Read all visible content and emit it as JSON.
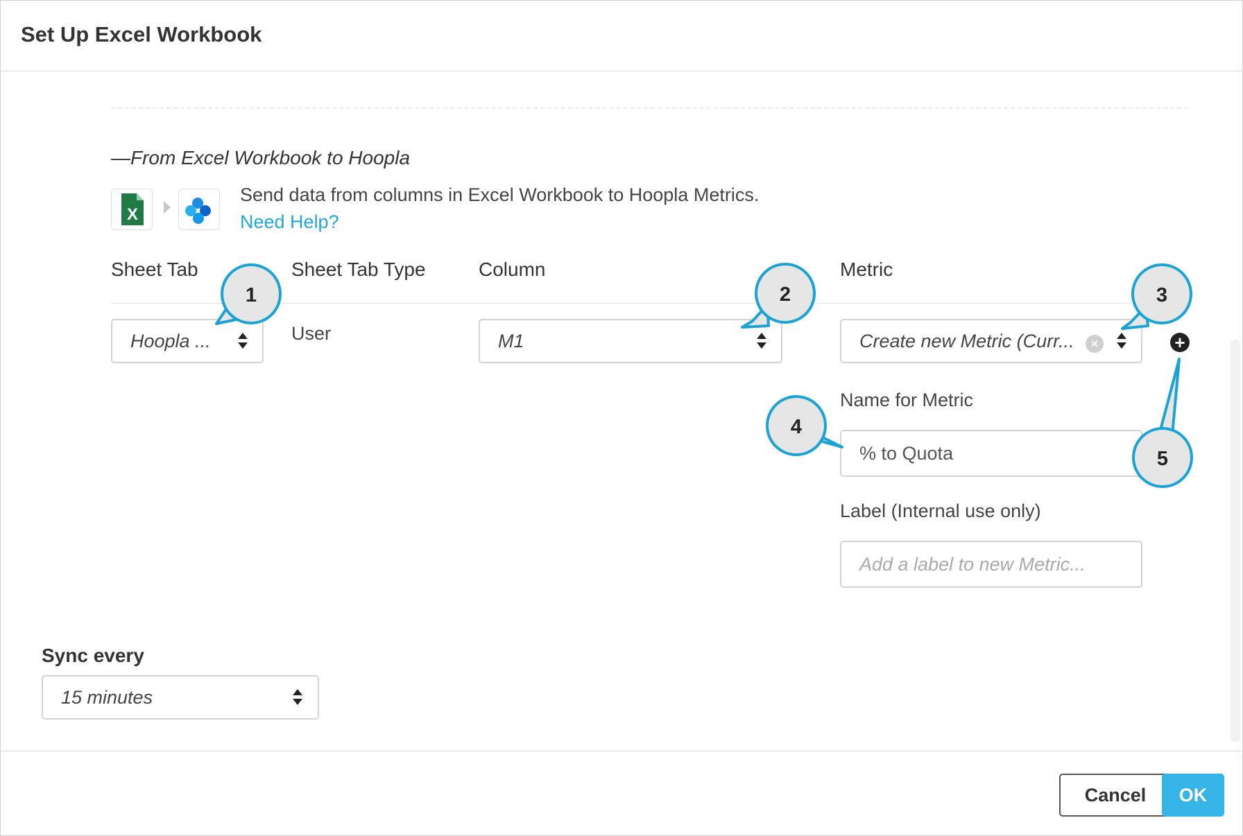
{
  "dialog": {
    "title": "Set Up Excel Workbook"
  },
  "section": {
    "title": "—From Excel Workbook to Hoopla",
    "description": "Send data from columns in Excel Workbook to Hoopla Metrics.",
    "help_link": "Need Help?",
    "icons": [
      "excel-icon",
      "hoopla-icon"
    ]
  },
  "columns": {
    "sheet_tab": "Sheet Tab",
    "sheet_tab_type": "Sheet Tab Type",
    "column": "Column",
    "metric": "Metric"
  },
  "row": {
    "sheet_tab_value": "Hoopla ...",
    "sheet_tab_type_value": "User",
    "column_value": "M1",
    "metric_value": "Create new Metric (Curr...",
    "name_for_metric_label": "Name for Metric",
    "name_for_metric_value": "% to Quota",
    "label_label": "Label (Internal use only)",
    "label_placeholder": "Add a label to new Metric..."
  },
  "sync": {
    "label": "Sync every",
    "value": "15 minutes"
  },
  "footer": {
    "cancel_label": "Cancel",
    "ok_label": "OK"
  },
  "callouts": [
    "1",
    "2",
    "3",
    "4",
    "5"
  ],
  "colors": {
    "accent": "#22a7d8",
    "ok_button": "#35b5e5",
    "callout_ring": "#1aa3d4",
    "callout_fill": "#e6e6e6"
  }
}
